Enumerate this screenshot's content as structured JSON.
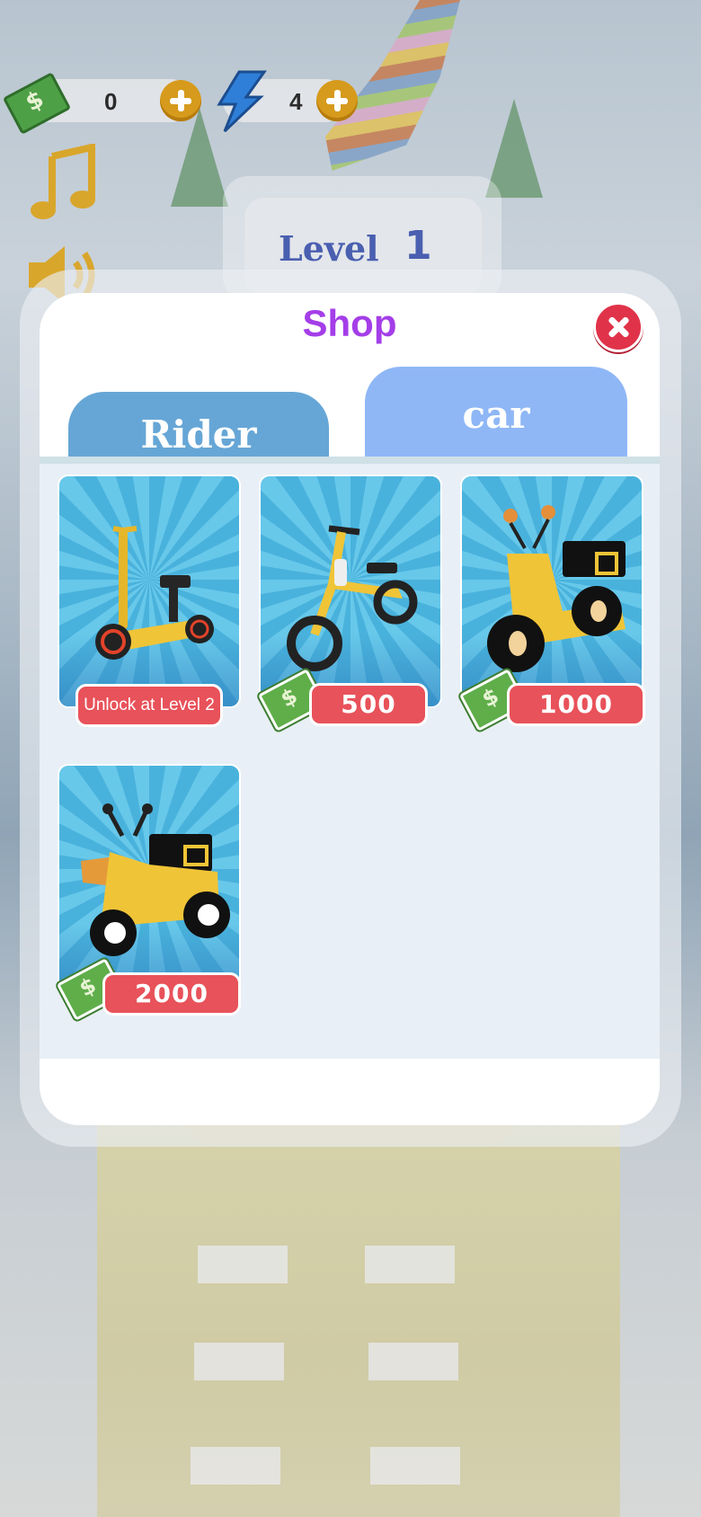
{
  "hud": {
    "coins": "0",
    "energy": "4"
  },
  "background": {
    "level_label": "Level",
    "level_number": "1"
  },
  "shop": {
    "title": "Shop",
    "tabs": [
      {
        "label": "Rider",
        "selected": false
      },
      {
        "label": "car",
        "selected": true
      }
    ],
    "items": [
      {
        "name": "electric-scooter",
        "status": "locked",
        "label": "Unlock at Level 2"
      },
      {
        "name": "balance-bike",
        "status": "price",
        "price": "500"
      },
      {
        "name": "yellow-moped",
        "status": "price",
        "price": "1000"
      },
      {
        "name": "delivery-tricycle",
        "status": "price",
        "price": "2000"
      }
    ]
  },
  "colors": {
    "title": "#a43ee8",
    "price_tag": "#e8525a",
    "tab_rider": "#66a6d6",
    "tab_car": "#8fb7f6",
    "close": "#e0334a"
  }
}
